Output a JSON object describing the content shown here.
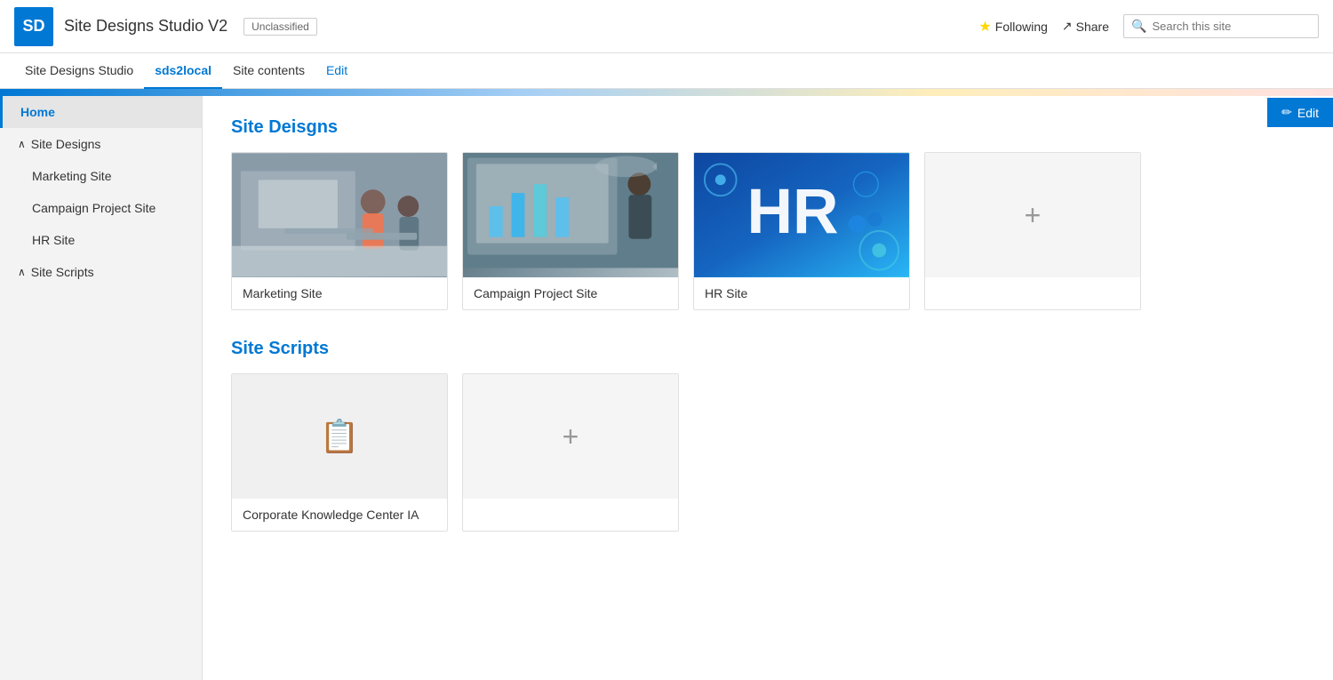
{
  "topbar": {
    "logo": "SD",
    "site_title": "Site Designs Studio V2",
    "unclassified": "Unclassified",
    "subtitle_breadcrumb": "Site Designs Studio",
    "nav_items": [
      {
        "label": "Site Designs Studio",
        "id": "site-designs-studio",
        "active": false,
        "edit": false
      },
      {
        "label": "sds2local",
        "id": "sds2local",
        "active": true,
        "edit": false
      },
      {
        "label": "Site contents",
        "id": "site-contents",
        "active": false,
        "edit": false
      },
      {
        "label": "Edit",
        "id": "edit-nav",
        "active": false,
        "edit": true
      }
    ],
    "following_label": "Following",
    "share_label": "Share",
    "search_placeholder": "Search this site"
  },
  "edit_button": "✏ Edit",
  "sidebar": {
    "home_label": "Home",
    "site_designs_label": "Site Designs",
    "site_designs_expanded": true,
    "site_designs_children": [
      {
        "label": "Marketing Site"
      },
      {
        "label": "Campaign Project Site"
      },
      {
        "label": "HR Site"
      }
    ],
    "site_scripts_label": "Site Scripts",
    "site_scripts_expanded": true
  },
  "site_designs_section": {
    "title": "Site Deisgns",
    "cards": [
      {
        "label": "Marketing Site",
        "id": "marketing",
        "type": "image"
      },
      {
        "label": "Campaign Project Site",
        "id": "campaign",
        "type": "image"
      },
      {
        "label": "HR Site",
        "id": "hr",
        "type": "image"
      },
      {
        "label": "",
        "id": "add-design",
        "type": "add"
      }
    ]
  },
  "site_scripts_section": {
    "title": "Site Scripts",
    "cards": [
      {
        "label": "Corporate Knowledge Center IA",
        "id": "corporate-knowledge",
        "type": "script"
      },
      {
        "label": "",
        "id": "add-script",
        "type": "add"
      }
    ]
  }
}
